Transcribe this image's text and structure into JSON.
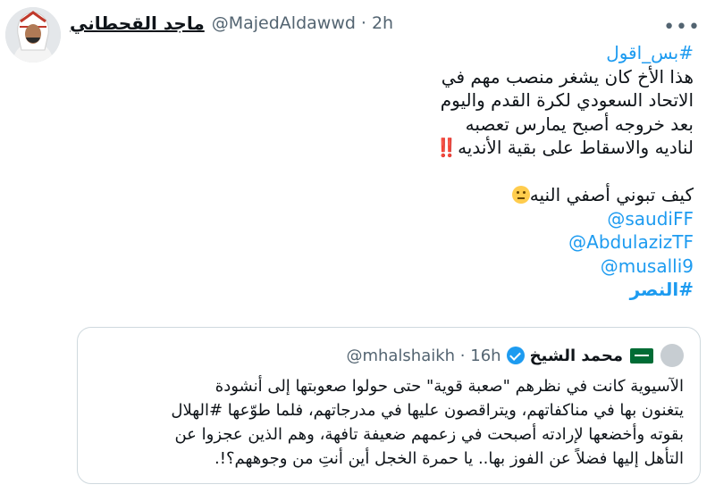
{
  "author": {
    "name": "ماجد القحطاني",
    "handle": "@MajedAldawwd",
    "separator": "·",
    "time": "2h",
    "avatar_icon": "profile-photo"
  },
  "more_label": "•••",
  "tweet": {
    "hashtag_top": "#بس_اقول",
    "lines": [
      "هذا الأخ كان يشغر منصب مهم في",
      "الاتحاد السعودي لكرة القدم واليوم",
      "بعد خروجه أصبح يمارس تعصبه",
      "لناديه والاسقاط على بقية الأنديه"
    ],
    "bangs": "‼️",
    "question": "كيف تبوني أصفي النيه",
    "mentions": [
      "@saudiFF",
      "@AbdulazizTF",
      "@musalli9"
    ],
    "hashtag_bottom": "#النصر"
  },
  "quote": {
    "name": "محمد الشيخ",
    "handle": "@mhalshaikh",
    "separator": "·",
    "time": "16h",
    "flag_icon": "saudi-flag",
    "verified_icon": "verified-badge",
    "lines": [
      "الآسيوية كانت في نظرهم \"صعبة قوية\" حتى حولوا صعوبتها إلى أنشودة",
      "يتغنون بها في مناكفاتهم، ويتراقصون عليها في مدرجاتهم، فلما طوّعها #الهلال",
      "بقوته وأخضعها لإرادته أصبحت في زعمهم ضعيفة تافهة، وهم الذين عجزوا عن",
      "التأهل إليها فضلاً عن الفوز بها.. يا حمرة الخجل أين أنتِ من وجوههم؟!."
    ]
  },
  "colors": {
    "link": "#1d9bf0",
    "muted": "#536471",
    "text": "#0f1419",
    "border": "#cfd9de"
  }
}
